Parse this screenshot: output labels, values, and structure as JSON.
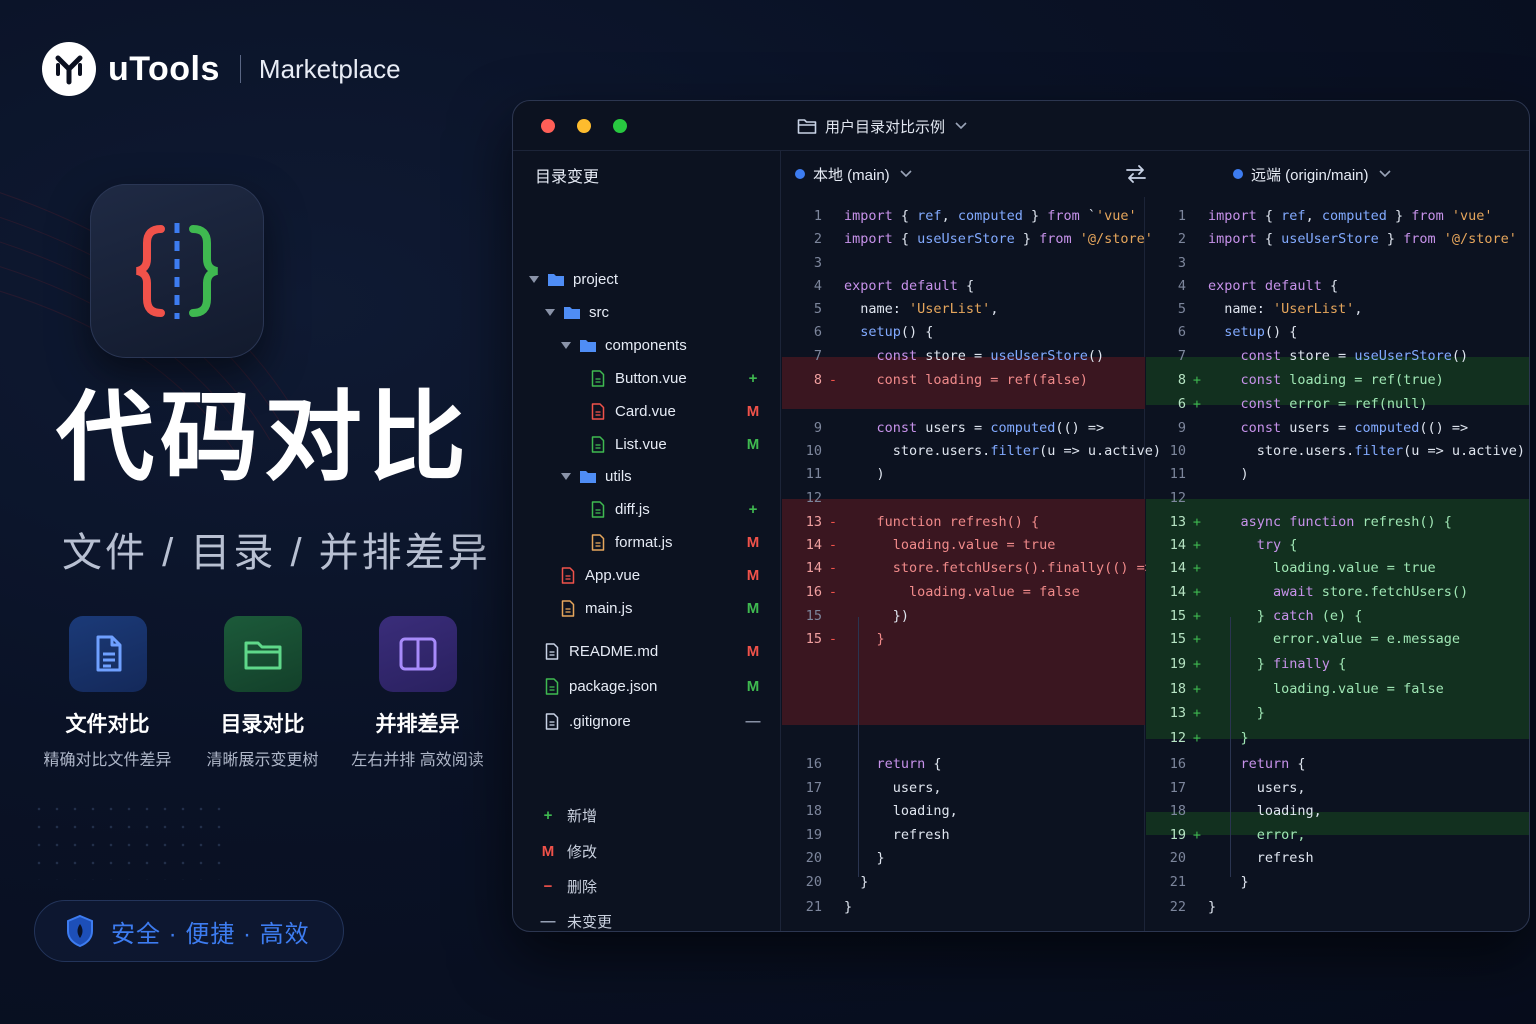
{
  "brand": {
    "name": "uTools",
    "marketplace": "Marketplace"
  },
  "hero": {
    "title": "代码对比",
    "subtitle": "文件 / 目录 / 并排差异"
  },
  "features": [
    {
      "title": "文件对比",
      "desc": "精确对比文件差异",
      "icon": "file-text-icon"
    },
    {
      "title": "目录对比",
      "desc": "清晰展示变更树",
      "icon": "folder-icon"
    },
    {
      "title": "并排差异",
      "desc": "左右并排 高效阅读",
      "icon": "split-view-icon"
    }
  ],
  "badge": {
    "text": "安全 · 便捷 · 高效"
  },
  "window": {
    "title": "用户目录对比示例",
    "sidebar_title": "目录变更",
    "left_branch": "本地 (main)",
    "right_branch": "远端 (origin/main)"
  },
  "tree": [
    {
      "label": "project",
      "type": "folder",
      "status": "",
      "caret": true
    },
    {
      "label": "src",
      "type": "folder",
      "status": "",
      "caret": true
    },
    {
      "label": "components",
      "type": "folder",
      "status": "",
      "caret": true
    },
    {
      "label": "Button.vue",
      "type": "file",
      "status": "+"
    },
    {
      "label": "Card.vue",
      "type": "file",
      "status": "M"
    },
    {
      "label": "List.vue",
      "type": "file",
      "status": "M"
    },
    {
      "label": "utils",
      "type": "folder",
      "status": "",
      "caret": true
    },
    {
      "label": "diff.js",
      "type": "file",
      "status": "+"
    },
    {
      "label": "format.js",
      "type": "file",
      "status": "M"
    },
    {
      "label": "App.vue",
      "type": "file",
      "status": "M"
    },
    {
      "label": "main.js",
      "type": "file",
      "status": "M"
    },
    {
      "label": "README.md",
      "type": "file",
      "status": "M"
    },
    {
      "label": "package.json",
      "type": "file",
      "status": "M"
    },
    {
      "label": ".gitignore",
      "type": "file",
      "status": "—"
    }
  ],
  "legend": [
    {
      "symbol": "+",
      "label": "新增"
    },
    {
      "symbol": "M",
      "label": "修改"
    },
    {
      "symbol": "−",
      "label": "删除"
    },
    {
      "symbol": "—",
      "label": "未变更"
    }
  ],
  "left_code": [
    {
      "n": "1",
      "m": "",
      "t": "import { ref, computed } from `'vue'"
    },
    {
      "n": "2",
      "m": "",
      "t": "import { useUserStore } from '@/store'"
    },
    {
      "n": "3",
      "m": "",
      "t": ""
    },
    {
      "n": "4",
      "m": "",
      "t": "export default {"
    },
    {
      "n": "5",
      "m": "",
      "t": "  name: 'UserList',"
    },
    {
      "n": "6",
      "m": "",
      "t": "  setup() {"
    },
    {
      "n": "7",
      "m": "",
      "t": "    const store = useUserStore()"
    },
    {
      "n": "8",
      "m": "-",
      "t": "    const loading = ref(false)"
    },
    {
      "n": "9",
      "m": "",
      "t": "    const users = computed(() =>"
    },
    {
      "n": "10",
      "m": "",
      "t": "      store.users.filter(u => u.active)"
    },
    {
      "n": "11",
      "m": "",
      "t": "    )"
    },
    {
      "n": "12",
      "m": "",
      "t": ""
    },
    {
      "n": "13",
      "m": "-",
      "t": "    function refresh() {"
    },
    {
      "n": "14",
      "m": "-",
      "t": "      loading.value = true"
    },
    {
      "n": "14",
      "m": "-",
      "t": "      store.fetchUsers().finally(() => {"
    },
    {
      "n": "16",
      "m": "-",
      "t": "        loading.value = false"
    },
    {
      "n": "15",
      "m": "",
      "t": "      })"
    },
    {
      "n": "15",
      "m": "-",
      "t": "    }"
    },
    {
      "n": "16",
      "m": "",
      "t": "    return {"
    },
    {
      "n": "17",
      "m": "",
      "t": "      users,"
    },
    {
      "n": "18",
      "m": "",
      "t": "      loading,"
    },
    {
      "n": "19",
      "m": "",
      "t": "      refresh"
    },
    {
      "n": "20",
      "m": "",
      "t": "    }"
    },
    {
      "n": "20",
      "m": "",
      "t": "  }"
    },
    {
      "n": "21",
      "m": "",
      "t": "}"
    }
  ],
  "right_code": [
    {
      "n": "1",
      "m": "",
      "t": "import { ref, computed } from 'vue'"
    },
    {
      "n": "2",
      "m": "",
      "t": "import { useUserStore } from '@/store'"
    },
    {
      "n": "3",
      "m": "",
      "t": ""
    },
    {
      "n": "4",
      "m": "",
      "t": "export default {"
    },
    {
      "n": "5",
      "m": "",
      "t": "  name: 'UserList',"
    },
    {
      "n": "6",
      "m": "",
      "t": "  setup() {"
    },
    {
      "n": "7",
      "m": "",
      "t": "    const store = useUserStore()"
    },
    {
      "n": "8",
      "m": "+",
      "t": "    const loading = ref(true)"
    },
    {
      "n": "6",
      "m": "+",
      "t": "    const error = ref(null)"
    },
    {
      "n": "9",
      "m": "",
      "t": "    const users = computed(() =>"
    },
    {
      "n": "10",
      "m": "",
      "t": "      store.users.filter(u => u.active)"
    },
    {
      "n": "11",
      "m": "",
      "t": "    )"
    },
    {
      "n": "12",
      "m": "",
      "t": ""
    },
    {
      "n": "13",
      "m": "+",
      "t": "    async function refresh() {"
    },
    {
      "n": "14",
      "m": "+",
      "t": "      try {"
    },
    {
      "n": "14",
      "m": "+",
      "t": "        loading.value = true"
    },
    {
      "n": "14",
      "m": "+",
      "t": "        await store.fetchUsers()"
    },
    {
      "n": "15",
      "m": "+",
      "t": "      } catch (e) {"
    },
    {
      "n": "15",
      "m": "+",
      "t": "        error.value = e.message"
    },
    {
      "n": "19",
      "m": "+",
      "t": "      } finally {"
    },
    {
      "n": "18",
      "m": "+",
      "t": "        loading.value = false"
    },
    {
      "n": "13",
      "m": "+",
      "t": "      }"
    },
    {
      "n": "12",
      "m": "+",
      "t": "    }"
    },
    {
      "n": "16",
      "m": "",
      "t": "    return {"
    },
    {
      "n": "17",
      "m": "",
      "t": "      users,"
    },
    {
      "n": "18",
      "m": "",
      "t": "      loading,"
    },
    {
      "n": "19",
      "m": "+",
      "t": "      error,"
    },
    {
      "n": "20",
      "m": "",
      "t": "      refresh"
    },
    {
      "n": "21",
      "m": "",
      "t": "    }"
    },
    {
      "n": "22",
      "m": "",
      "t": "}"
    }
  ],
  "colors": {
    "accent": "#3d7cf0",
    "added": "#3fb950",
    "deleted": "#f0524a",
    "added_bg": "#12301f",
    "deleted_bg": "#3a1620"
  }
}
